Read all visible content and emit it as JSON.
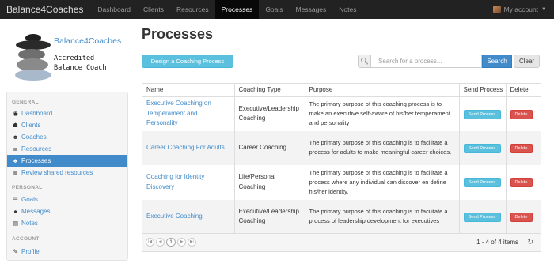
{
  "navbar": {
    "brand": "Balance4Coaches",
    "items": [
      "Dashboard",
      "Clients",
      "Resources",
      "Processes",
      "Goals",
      "Messages",
      "Notes"
    ],
    "active": "Processes",
    "account_label": "My account"
  },
  "profile": {
    "name": "Balance4Coaches",
    "role_line1": "Accredited",
    "role_line2": "Balance Coach"
  },
  "sidebar": {
    "general_label": "GENERAL",
    "general": [
      {
        "label": "Dashboard",
        "icon": "dashboard-icon"
      },
      {
        "label": "Clients",
        "icon": "users-icon"
      },
      {
        "label": "Coaches",
        "icon": "user-icon"
      },
      {
        "label": "Resources",
        "icon": "database-icon"
      },
      {
        "label": "Processes",
        "icon": "process-icon"
      },
      {
        "label": "Review shared resources",
        "icon": "database-icon"
      }
    ],
    "personal_label": "PERSONAL",
    "personal": [
      {
        "label": "Goals",
        "icon": "list-icon"
      },
      {
        "label": "Messages",
        "icon": "comments-icon"
      },
      {
        "label": "Notes",
        "icon": "file-icon"
      }
    ],
    "account_label": "ACCOUNT",
    "account": [
      {
        "label": "Profile",
        "icon": "edit-icon"
      }
    ]
  },
  "main": {
    "title": "Processes",
    "design_button": "Design a Coaching Process",
    "search_placeholder": "Search for a process...",
    "search_button": "Search",
    "clear_button": "Clear",
    "table": {
      "headers": [
        "Name",
        "Coaching Type",
        "Purpose",
        "Send Process",
        "Delete"
      ],
      "rows": [
        {
          "name": "Executive Coaching on Temperament and Personality",
          "type": "Executive/Leadership Coaching",
          "purpose": "The primary purpose of this coaching process is to make an executive self-aware of his/her temperament and personality"
        },
        {
          "name": "Career Coaching For Adults",
          "type": "Career Coaching",
          "purpose": "The primary purpose of this coaching is to facilitate a process for adults to make meaningful career choices."
        },
        {
          "name": "Coaching for Identity Discovery",
          "type": "Life/Personal Coaching",
          "purpose": "The primary purpose of this coaching is to facilitate a process where any individual can discover en define his/her identity."
        },
        {
          "name": "Executive Coaching",
          "type": "Executive/Leadership Coaching",
          "purpose": "The primary purpose of this coaching is to facilitate a process of leadership development for executives"
        }
      ],
      "send_label": "Send Process",
      "delete_label": "Delete"
    },
    "pager": {
      "current_page": "1",
      "count_text": "1 - 4 of 4 items"
    }
  },
  "colors": {
    "navbar_bg": "#222222",
    "primary": "#428bca",
    "info": "#5bc0de",
    "danger": "#d9534f"
  }
}
